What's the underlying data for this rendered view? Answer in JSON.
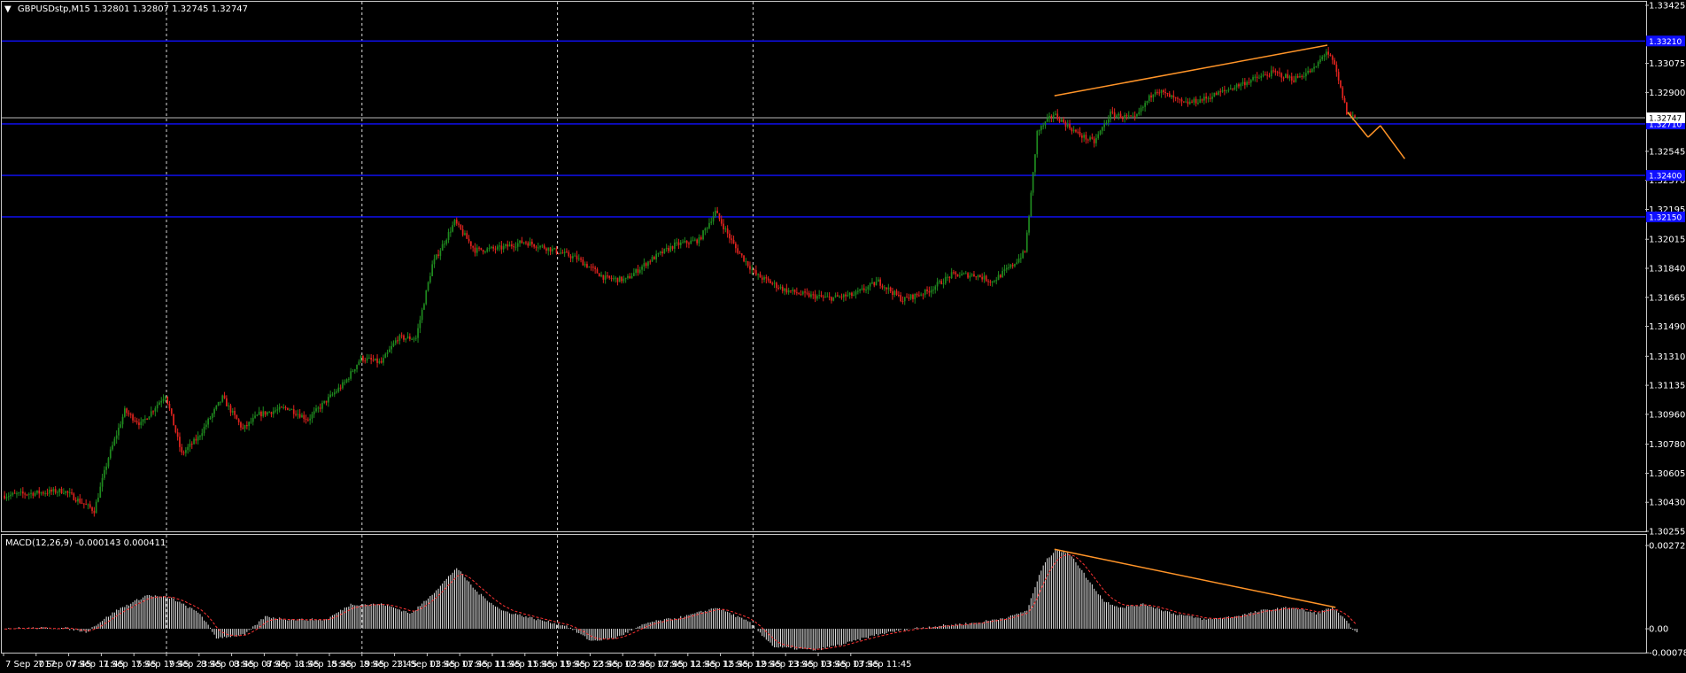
{
  "colors": {
    "background": "#000000",
    "axis": "#c8c8c8",
    "bull": "#1f8a1f",
    "bear": "#e0231e",
    "level": "#1010ff",
    "trend": "#ff9428",
    "grid_separator": "#ffffff",
    "price_line": "#b8b8b8",
    "macd_hist": "#e6e6e6",
    "macd_signal": "#ff3333"
  },
  "main_header": {
    "arrow": "▼",
    "text": "GBPUSDstp,M15  1.32801 1.32807 1.32745 1.32747"
  },
  "macd_header": {
    "text": "MACD(12,26,9) -0.000143 0.000411"
  },
  "chart_data": [
    {
      "type": "candlestick",
      "symbol": "GBPUSDstp",
      "timeframe": "M15",
      "ylim": [
        1.30255,
        1.33425
      ],
      "y_ticks": [
        "1.33425",
        "1.33075",
        "1.32900",
        "1.32545",
        "1.32370",
        "1.32195",
        "1.32015",
        "1.31840",
        "1.31665",
        "1.31490",
        "1.31310",
        "1.31135",
        "1.30960",
        "1.30780",
        "1.30605",
        "1.30430",
        "1.30255"
      ],
      "x_tick_labels": [
        "7 Sep 2017",
        "7 Sep 07:45",
        "7 Sep 11:45",
        "7 Sep 15:45",
        "7 Sep 19:45",
        "7 Sep 23:45",
        "8 Sep 03:45",
        "8 Sep 07:45",
        "8 Sep 11:45",
        "8 Sep 15:45",
        "8 Sep 19:45",
        "8 Sep 23:45",
        "11 Sep 03:45",
        "11 Sep 07:45",
        "11 Sep 11:45",
        "11 Sep 15:45",
        "11 Sep 19:45",
        "11 Sep 23:45",
        "12 Sep 03:45",
        "12 Sep 07:45",
        "12 Sep 11:45",
        "12 Sep 15:45",
        "12 Sep 19:45",
        "12 Sep 23:45",
        "13 Sep 03:45",
        "13 Sep 07:45",
        "13 Sep 11:45"
      ],
      "day_separators": [
        "7 Sep 23:45",
        "8 Sep 23:45",
        "11 Sep 23:45",
        "12 Sep 23:45"
      ],
      "current_price": "1.32747",
      "horizontal_levels": [
        {
          "price": 1.3321,
          "label": "1.33210"
        },
        {
          "price": 1.3271,
          "label": "1.32710"
        },
        {
          "price": 1.324,
          "label": "1.32400"
        },
        {
          "price": 1.3215,
          "label": "1.32150"
        }
      ],
      "price_path": [
        [
          0,
          1.3047
        ],
        [
          30,
          1.305
        ],
        [
          45,
          1.3038
        ],
        [
          52,
          1.307
        ],
        [
          60,
          1.3098
        ],
        [
          68,
          1.309
        ],
        [
          80,
          1.3108
        ],
        [
          88,
          1.3072
        ],
        [
          96,
          1.3082
        ],
        [
          108,
          1.3106
        ],
        [
          118,
          1.3087
        ],
        [
          126,
          1.3096
        ],
        [
          140,
          1.31
        ],
        [
          150,
          1.3093
        ],
        [
          158,
          1.3103
        ],
        [
          168,
          1.3115
        ],
        [
          176,
          1.313
        ],
        [
          186,
          1.3127
        ],
        [
          194,
          1.3142
        ],
        [
          203,
          1.3142
        ],
        [
          211,
          1.3186
        ],
        [
          222,
          1.3212
        ],
        [
          232,
          1.3195
        ],
        [
          244,
          1.3196
        ],
        [
          256,
          1.32
        ],
        [
          268,
          1.3196
        ],
        [
          282,
          1.319
        ],
        [
          296,
          1.3178
        ],
        [
          306,
          1.3177
        ],
        [
          318,
          1.3189
        ],
        [
          330,
          1.3198
        ],
        [
          342,
          1.3201
        ],
        [
          350,
          1.3218
        ],
        [
          360,
          1.3196
        ],
        [
          370,
          1.318
        ],
        [
          384,
          1.3171
        ],
        [
          394,
          1.3168
        ],
        [
          406,
          1.3166
        ],
        [
          418,
          1.3168
        ],
        [
          430,
          1.3176
        ],
        [
          442,
          1.3165
        ],
        [
          454,
          1.317
        ],
        [
          466,
          1.318
        ],
        [
          478,
          1.318
        ],
        [
          486,
          1.3176
        ],
        [
          496,
          1.3186
        ],
        [
          502,
          1.3194
        ],
        [
          504,
          1.3216
        ],
        [
          508,
          1.3266
        ],
        [
          516,
          1.3277
        ],
        [
          528,
          1.3265
        ],
        [
          536,
          1.326
        ],
        [
          544,
          1.3277
        ],
        [
          556,
          1.3274
        ],
        [
          566,
          1.3292
        ],
        [
          580,
          1.3283
        ],
        [
          590,
          1.3286
        ],
        [
          602,
          1.3292
        ],
        [
          612,
          1.3297
        ],
        [
          624,
          1.3302
        ],
        [
          634,
          1.3298
        ],
        [
          644,
          1.3304
        ],
        [
          650,
          1.3315
        ],
        [
          654,
          1.3306
        ],
        [
          660,
          1.3278
        ],
        [
          664,
          1.3275
        ]
      ],
      "candle_count": 665,
      "trend_lines": [
        {
          "from": [
            516,
            1.3288
          ],
          "to": [
            650,
            1.33185
          ]
        },
        {
          "from": [
            660,
            1.3278
          ],
          "to": [
            670,
            1.3263
          ]
        },
        {
          "from": [
            670,
            1.3263
          ],
          "to": [
            676,
            1.327
          ]
        },
        {
          "from": [
            676,
            1.327
          ],
          "to": [
            688,
            1.325
          ]
        }
      ]
    },
    {
      "type": "bar",
      "name": "MACD(12,26,9)",
      "macd_value": "-0.000143",
      "signal_value": "0.000411",
      "ylim": [
        -0.00078,
        0.002723
      ],
      "y_ticks": [
        "0.002723",
        "0.00",
        "-0.000787"
      ],
      "hist_path": [
        [
          0,
          2e-05
        ],
        [
          30,
          2e-05
        ],
        [
          40,
          -0.0001
        ],
        [
          55,
          0.0006
        ],
        [
          70,
          0.0011
        ],
        [
          82,
          0.001
        ],
        [
          96,
          0.0005
        ],
        [
          104,
          -0.0003
        ],
        [
          118,
          -0.0002
        ],
        [
          128,
          0.0004
        ],
        [
          140,
          0.0003
        ],
        [
          158,
          0.0003
        ],
        [
          170,
          0.0008
        ],
        [
          186,
          0.0008
        ],
        [
          200,
          0.0005
        ],
        [
          214,
          0.0014
        ],
        [
          222,
          0.002
        ],
        [
          232,
          0.0012
        ],
        [
          244,
          0.0006
        ],
        [
          262,
          0.0003
        ],
        [
          276,
          0.0001
        ],
        [
          288,
          -0.0004
        ],
        [
          300,
          -0.0003
        ],
        [
          316,
          0.0002
        ],
        [
          334,
          0.0004
        ],
        [
          350,
          0.0007
        ],
        [
          366,
          0.0002
        ],
        [
          378,
          -0.0006
        ],
        [
          398,
          -0.0007
        ],
        [
          412,
          -0.0005
        ],
        [
          428,
          -0.0002
        ],
        [
          444,
          0.0
        ],
        [
          460,
          0.0001
        ],
        [
          478,
          0.0002
        ],
        [
          494,
          0.0004
        ],
        [
          502,
          0.0006
        ],
        [
          510,
          0.0021
        ],
        [
          516,
          0.0026
        ],
        [
          524,
          0.0024
        ],
        [
          532,
          0.0016
        ],
        [
          540,
          0.0009
        ],
        [
          548,
          0.0007
        ],
        [
          560,
          0.0008
        ],
        [
          574,
          0.0005
        ],
        [
          590,
          0.0003
        ],
        [
          604,
          0.0004
        ],
        [
          618,
          0.0006
        ],
        [
          632,
          0.0007
        ],
        [
          644,
          0.0005
        ],
        [
          652,
          0.0007
        ],
        [
          658,
          0.0003
        ],
        [
          664,
          -0.00014
        ]
      ],
      "trend_line": {
        "from": [
          516,
          0.0026
        ],
        "to": [
          654,
          0.0007
        ]
      }
    }
  ]
}
